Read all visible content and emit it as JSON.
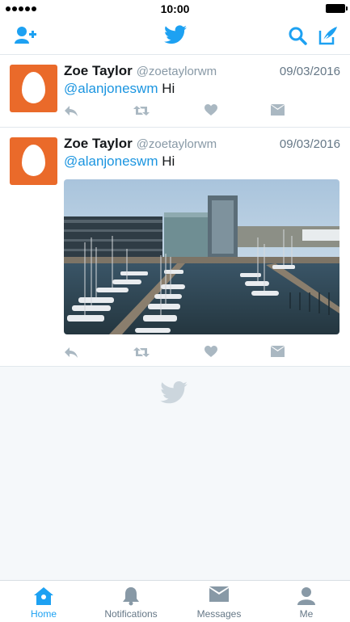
{
  "status_bar": {
    "time": "10:00"
  },
  "nav": {
    "left_icon": "add-user-icon",
    "center_icon": "twitter-bird-icon",
    "right_icons": [
      "search-icon",
      "compose-icon"
    ],
    "accent_color": "#1da1f2"
  },
  "tweets": [
    {
      "name": "Zoe Taylor",
      "handle": "@zoetaylorwm",
      "date": "09/03/2016",
      "mention": "@alanjoneswm",
      "text": "Hi",
      "has_media": false
    },
    {
      "name": "Zoe Taylor",
      "handle": "@zoetaylorwm",
      "date": "09/03/2016",
      "mention": "@alanjoneswm",
      "text": "Hi",
      "has_media": true,
      "media_icon": "harbor-photo"
    }
  ],
  "tab_bar": {
    "tabs": [
      {
        "label": "Home",
        "icon": "home-icon",
        "active": true
      },
      {
        "label": "Notifications",
        "icon": "bell-icon",
        "active": false
      },
      {
        "label": "Messages",
        "icon": "envelope-icon",
        "active": false
      },
      {
        "label": "Me",
        "icon": "person-icon",
        "active": false
      }
    ]
  }
}
